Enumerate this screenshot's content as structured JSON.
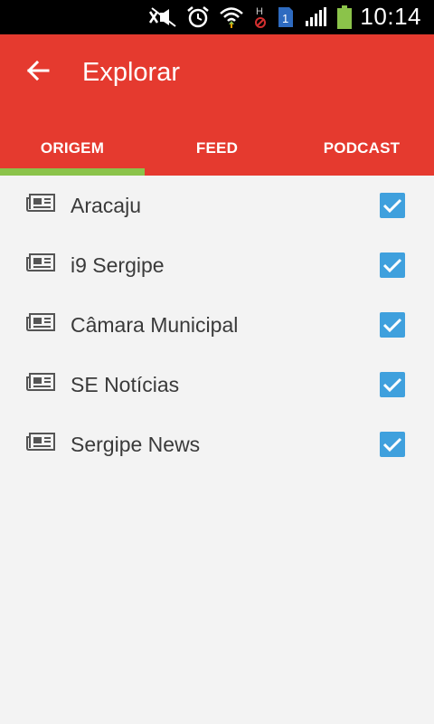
{
  "status_bar": {
    "time": "10:14",
    "icons": [
      "mute-icon",
      "alarm-icon",
      "wifi-icon",
      "signal-blocked-icon",
      "sim-1-icon",
      "cell-signal-icon",
      "battery-icon"
    ],
    "sim_label": "1",
    "network_label": "H"
  },
  "app_bar": {
    "title": "Explorar",
    "back_icon": "arrow-left-icon",
    "background": "#e53a2f"
  },
  "tabs": [
    {
      "label": "ORIGEM",
      "selected": true
    },
    {
      "label": "FEED",
      "selected": false
    },
    {
      "label": "PODCAST",
      "selected": false
    }
  ],
  "tab_indicator_color": "#8bc34a",
  "sources": [
    {
      "label": "Aracaju",
      "checked": true,
      "icon": "newspaper-icon"
    },
    {
      "label": "i9 Sergipe",
      "checked": true,
      "icon": "newspaper-icon"
    },
    {
      "label": "Câmara Municipal",
      "checked": true,
      "icon": "newspaper-icon"
    },
    {
      "label": "SE Notícias",
      "checked": true,
      "icon": "newspaper-icon"
    },
    {
      "label": "Sergipe News",
      "checked": true,
      "icon": "newspaper-icon"
    }
  ],
  "checkbox_color": "#3fa0dd"
}
